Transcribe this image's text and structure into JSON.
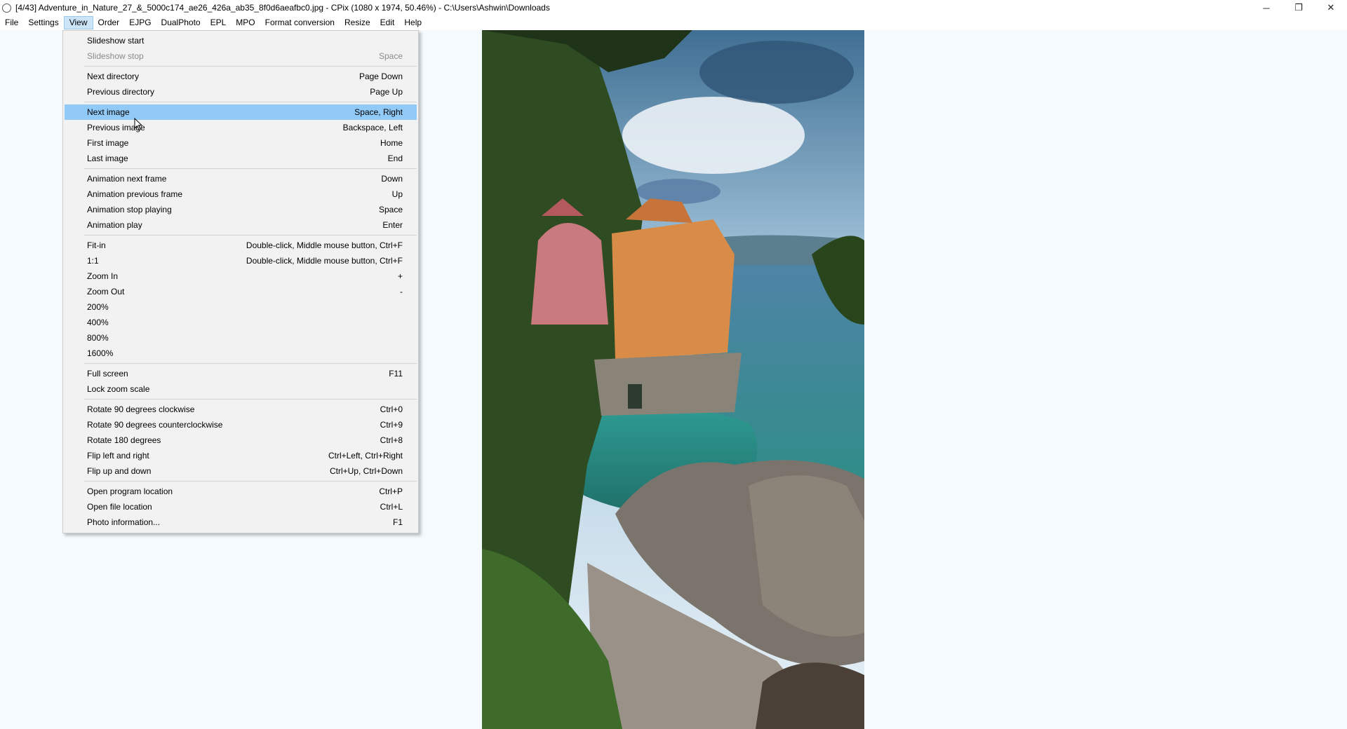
{
  "window": {
    "title": "[4/43] Adventure_in_Nature_27_&_5000c174_ae26_426a_ab35_8f0d6aeafbc0.jpg - CPix (1080 x 1974, 50.46%) - C:\\Users\\Ashwin\\Downloads",
    "minimize": "─",
    "maximize": "❐",
    "close": "✕"
  },
  "menubar": {
    "items": [
      "File",
      "Settings",
      "View",
      "Order",
      "EJPG",
      "DualPhoto",
      "EPL",
      "MPO",
      "Format conversion",
      "Resize",
      "Edit",
      "Help"
    ],
    "active": "View"
  },
  "view_menu": {
    "groups": [
      [
        {
          "label": "Slideshow start",
          "shortcut": ""
        },
        {
          "label": "Slideshow stop",
          "shortcut": "Space",
          "disabled": true
        }
      ],
      [
        {
          "label": "Next directory",
          "shortcut": "Page Down"
        },
        {
          "label": "Previous directory",
          "shortcut": "Page Up"
        }
      ],
      [
        {
          "label": "Next image",
          "shortcut": "Space, Right",
          "highlight": true
        },
        {
          "label": "Previous image",
          "shortcut": "Backspace, Left"
        },
        {
          "label": "First image",
          "shortcut": "Home"
        },
        {
          "label": "Last image",
          "shortcut": "End"
        }
      ],
      [
        {
          "label": "Animation next frame",
          "shortcut": "Down"
        },
        {
          "label": "Animation previous frame",
          "shortcut": "Up"
        },
        {
          "label": "Animation stop playing",
          "shortcut": "Space"
        },
        {
          "label": "Animation play",
          "shortcut": "Enter"
        }
      ],
      [
        {
          "label": "Fit-in",
          "shortcut": "Double-click, Middle mouse button, Ctrl+F"
        },
        {
          "label": "1:1",
          "shortcut": "Double-click, Middle mouse button, Ctrl+F"
        },
        {
          "label": "Zoom In",
          "shortcut": "+"
        },
        {
          "label": "Zoom Out",
          "shortcut": "-"
        },
        {
          "label": "200%",
          "shortcut": ""
        },
        {
          "label": "400%",
          "shortcut": ""
        },
        {
          "label": "800%",
          "shortcut": ""
        },
        {
          "label": "1600%",
          "shortcut": ""
        }
      ],
      [
        {
          "label": "Full screen",
          "shortcut": "F11"
        },
        {
          "label": "Lock zoom scale",
          "shortcut": ""
        }
      ],
      [
        {
          "label": "Rotate 90 degrees clockwise",
          "shortcut": "Ctrl+0"
        },
        {
          "label": "Rotate 90 degrees counterclockwise",
          "shortcut": "Ctrl+9"
        },
        {
          "label": "Rotate 180 degrees",
          "shortcut": "Ctrl+8"
        },
        {
          "label": "Flip left and right",
          "shortcut": "Ctrl+Left, Ctrl+Right"
        },
        {
          "label": "Flip up and down",
          "shortcut": "Ctrl+Up, Ctrl+Down"
        }
      ],
      [
        {
          "label": "Open program location",
          "shortcut": "Ctrl+P"
        },
        {
          "label": "Open file location",
          "shortcut": "Ctrl+L"
        },
        {
          "label": "Photo information...",
          "shortcut": "F1"
        }
      ]
    ]
  },
  "colors": {
    "highlight": "#91c9f7",
    "menu_bg": "#f2f2f2",
    "canvas_bg": "#f4fafd"
  }
}
